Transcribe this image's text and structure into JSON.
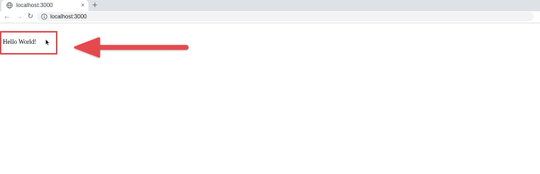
{
  "browser": {
    "tab": {
      "title": "localhost:3000",
      "close_glyph": "×",
      "favicon": "globe-icon"
    },
    "new_tab_glyph": "+",
    "toolbar": {
      "back_glyph": "←",
      "forward_glyph": "→",
      "reload_glyph": "↻",
      "url": "localhost:3000",
      "url_icon": "info-icon"
    }
  },
  "page": {
    "greeting": "Hello World!"
  },
  "annotation": {
    "color": "#e5484d",
    "highlight": "red-rectangle",
    "pointer": "red-arrow-left"
  }
}
